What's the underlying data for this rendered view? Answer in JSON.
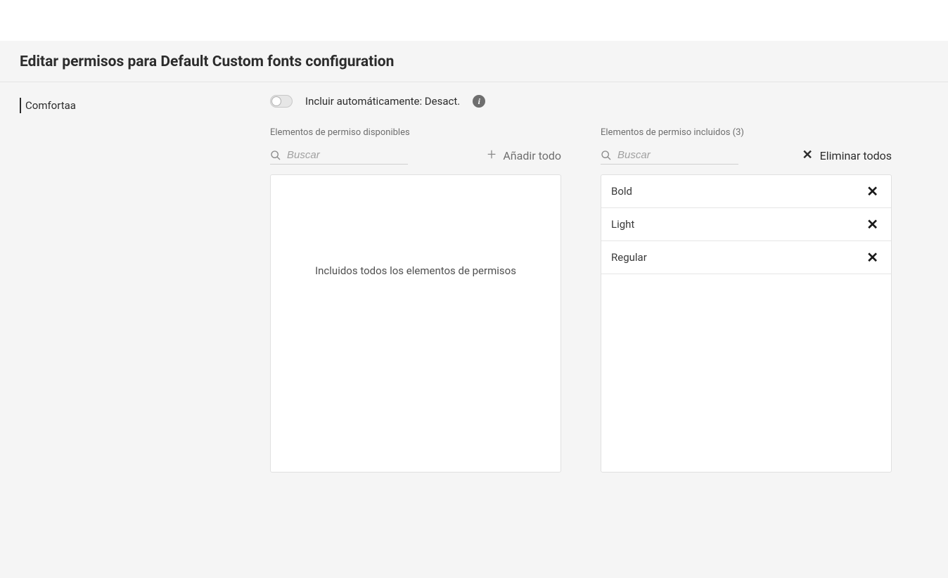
{
  "page_title": "Editar permisos para Default Custom fonts configuration",
  "sidebar": {
    "items": [
      {
        "label": "Comfortaa"
      }
    ]
  },
  "auto_include": {
    "label": "Incluir automáticamente: Desact.",
    "state": "off"
  },
  "available": {
    "header": "Elementos de permiso disponibles",
    "search_placeholder": "Buscar",
    "add_all_label": "Añadir todo",
    "empty_message": "Incluidos todos los elementos de permisos"
  },
  "included": {
    "header": "Elementos de permiso incluidos (3)",
    "search_placeholder": "Buscar",
    "remove_all_label": "Eliminar todos",
    "items": [
      {
        "label": "Bold"
      },
      {
        "label": "Light"
      },
      {
        "label": "Regular"
      }
    ]
  }
}
